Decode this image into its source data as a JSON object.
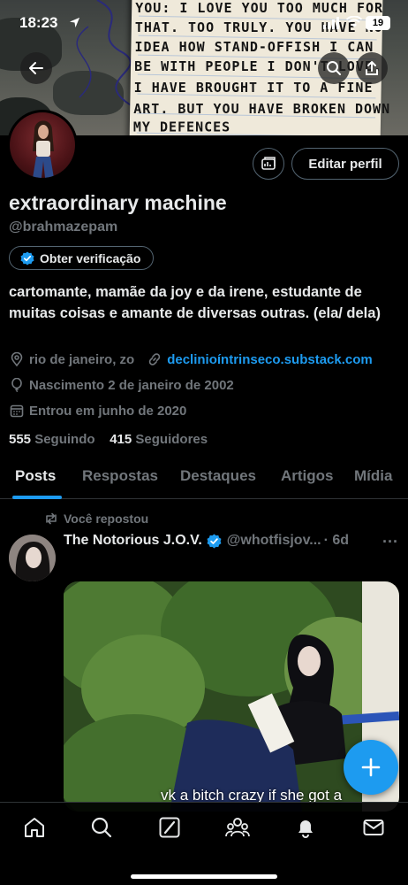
{
  "status_bar": {
    "time": "18:23",
    "battery": "19"
  },
  "banner": {
    "note_lines": [
      "YOU: I LOVE YOU TOO MUCH FOR",
      "THAT. TOO TRULY. YOU HAVE NO",
      "IDEA HOW STAND-OFFISH I CAN",
      "BE WITH PEOPLE I DON'T LOVE.",
      "I HAVE BROUGHT IT TO A FINE",
      "ART. BUT YOU HAVE BROKEN DOWN",
      "MY DEFENCES"
    ]
  },
  "profile": {
    "name": "extraordinary machine",
    "handle": "@brahmazepam",
    "edit_label": "Editar perfil",
    "verify_label": "Obter verificação",
    "bio": "cartomante, mamãe da joy e da irene, estudante de muitas coisas e amante de diversas outras. (ela/ dela)",
    "location": "rio de janeiro, zo",
    "website": "declinioíntrinseco.substack.com",
    "birthday": "Nascimento 2 de janeiro de 2002",
    "joined": "Entrou em junho de 2020",
    "following_count": "555",
    "following_label": "Seguindo",
    "followers_count": "415",
    "followers_label": "Seguidores"
  },
  "tabs": [
    {
      "label": "Posts"
    },
    {
      "label": "Respostas"
    },
    {
      "label": "Destaques"
    },
    {
      "label": "Artigos"
    },
    {
      "label": "Mídia"
    }
  ],
  "post": {
    "repost_label": "Você repostou",
    "author_name": "The Notorious J.O.V.",
    "author_handle": "@whotfisjov...",
    "time": "· 6d",
    "more": "···",
    "media_caption": "vk a bitch crazy if she got a"
  },
  "colors": {
    "accent": "#1d9bf0",
    "muted": "#71767b",
    "text": "#e7e9ea",
    "border": "#2f3336"
  },
  "bottom_nav": [
    "home-icon",
    "search-icon",
    "grok-icon",
    "communities-icon",
    "notifications-icon",
    "messages-icon"
  ]
}
